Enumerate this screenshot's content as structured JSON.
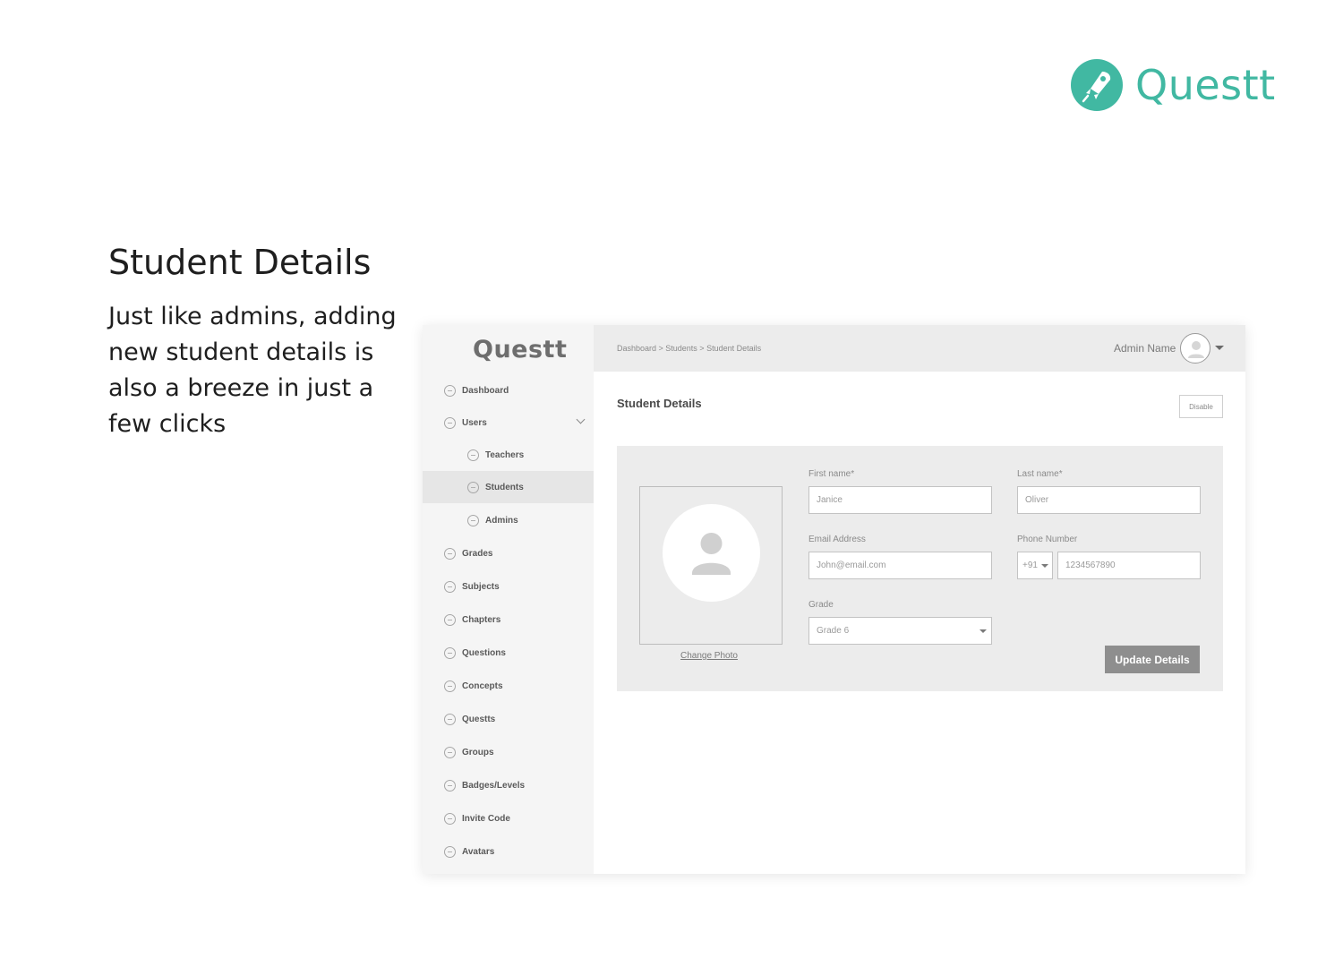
{
  "brand": {
    "name": "Questt",
    "color": "#41b8a2",
    "icon": "rocket-icon"
  },
  "intro": {
    "title": "Student Details",
    "body": "Just like admins, adding new student details is also a breeze in just a few clicks"
  },
  "app": {
    "sidebar": {
      "logo": "Questt",
      "items": [
        {
          "label": "Dashboard",
          "icon": "circle-icon"
        },
        {
          "label": "Users",
          "icon": "circle-icon",
          "expanded": true
        },
        {
          "label": "Teachers",
          "icon": "circle-icon"
        },
        {
          "label": "Students",
          "icon": "circle-icon",
          "active": true
        },
        {
          "label": "Admins",
          "icon": "circle-icon"
        },
        {
          "label": "Grades",
          "icon": "circle-icon"
        },
        {
          "label": "Subjects",
          "icon": "circle-icon"
        },
        {
          "label": "Chapters",
          "icon": "circle-icon"
        },
        {
          "label": "Questions",
          "icon": "circle-icon"
        },
        {
          "label": "Concepts",
          "icon": "circle-icon"
        },
        {
          "label": "Questts",
          "icon": "circle-icon"
        },
        {
          "label": "Groups",
          "icon": "circle-icon"
        },
        {
          "label": "Badges/Levels",
          "icon": "circle-icon"
        },
        {
          "label": "Invite Code",
          "icon": "circle-icon"
        },
        {
          "label": "Avatars",
          "icon": "circle-icon"
        }
      ]
    },
    "header": {
      "breadcrumb": "Dashboard > Students > Student Details",
      "admin_name": "Admin Name"
    },
    "page_title": "Student Details",
    "disable_label": "Disable",
    "form": {
      "first_name_label": "First name*",
      "first_name_value": "Janice",
      "last_name_label": "Last name*",
      "last_name_value": "Oliver",
      "email_label": "Email Address",
      "email_value": "John@email.com",
      "phone_label": "Phone Number",
      "phone_code": "+91",
      "phone_value": "1234567890",
      "grade_label": "Grade",
      "grade_value": "Grade 6",
      "change_photo": "Change Photo",
      "update_label": "Update Details"
    }
  }
}
